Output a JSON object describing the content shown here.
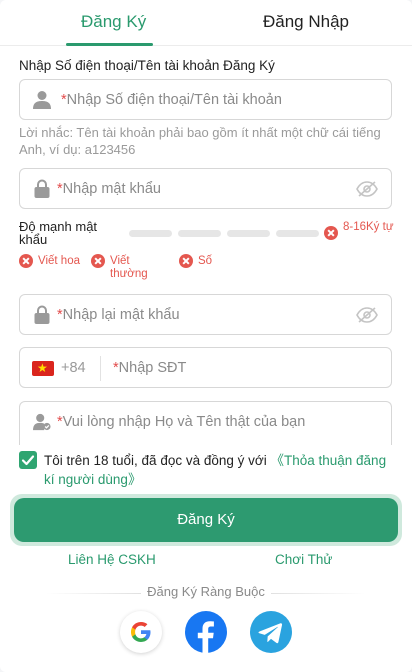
{
  "tabs": {
    "register": "Đăng Ký",
    "login": "Đăng Nhập"
  },
  "form": {
    "title": "Nhập Số điện thoại/Tên tài khoản Đăng Ký",
    "account_placeholder": "Nhập Số điện thoại/Tên tài khoản",
    "hint": "Lời nhắc: Tên tài khoản phải bao gồm ít nhất một chữ cái tiếng Anh, ví dụ: a123456",
    "password_placeholder": "Nhập mật khẩu",
    "strength_label": "Độ mạnh mật khẩu",
    "strength_bars": 4,
    "rule_length": "8-16Ký tự",
    "rule_upper": "Viết hoa",
    "rule_lower": "Viết thường",
    "rule_digit": "Số",
    "confirm_placeholder": "Nhập lại mật khẩu",
    "country_code": "+84",
    "phone_placeholder": "Nhập SĐT",
    "name_placeholder": "Vui lòng nhập Họ và Tên thật của bạn",
    "required_mark": "*"
  },
  "agreement": {
    "checked": true,
    "text": "Tôi trên 18 tuổi, đã đọc và đồng ý với ",
    "link": "《Thỏa thuận đăng kí người dùng》"
  },
  "actions": {
    "submit": "Đăng Ký",
    "support": "Liên Hệ CSKH",
    "trial": "Chơi Thử"
  },
  "social": {
    "title": "Đăng Ký Ràng Buộc",
    "items": [
      "google-icon",
      "facebook-icon",
      "telegram-icon"
    ]
  },
  "colors": {
    "accent": "#2a9a6e",
    "button": "#2d9a70",
    "error": "#e4574f",
    "facebook": "#1877f2",
    "telegram": "#2aa3df"
  }
}
